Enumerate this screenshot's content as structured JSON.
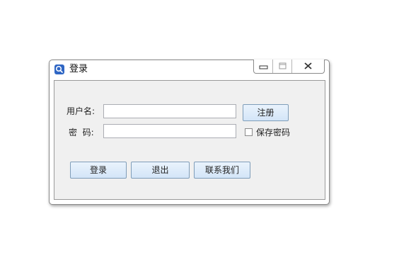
{
  "window": {
    "title": "登录",
    "app_icon": "search-icon",
    "controls": {
      "minimize": "minimize-icon",
      "maximize": "maximize-icon",
      "close": "close-icon"
    }
  },
  "form": {
    "username_label": "用户名:",
    "username_value": "",
    "password_label": "密  码:",
    "password_value": "",
    "register_label": "注册",
    "remember_label": "保存密码",
    "remember_checked": false
  },
  "actions": {
    "login_label": "登录",
    "exit_label": "退出",
    "contact_label": "联系我们"
  },
  "colors": {
    "accent": "#2f66c4",
    "button_border": "#7f9db9",
    "panel_bg": "#f0f0f0"
  }
}
